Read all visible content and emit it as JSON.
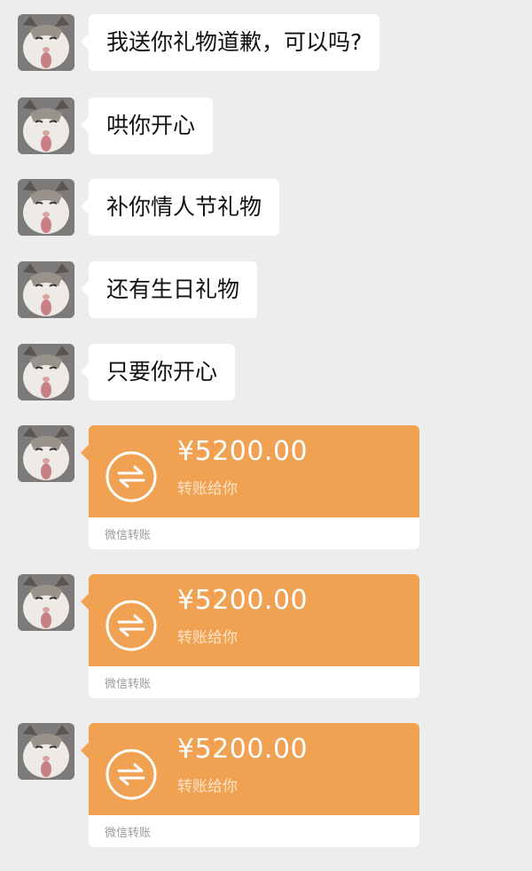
{
  "messages": [
    {
      "text": "我送你礼物道歉，可以吗?"
    },
    {
      "text": "哄你开心"
    },
    {
      "text": "补你情人节礼物"
    },
    {
      "text": "还有生日礼物"
    },
    {
      "text": "只要你开心"
    }
  ],
  "transfers": [
    {
      "amount": "¥5200.00",
      "desc": "转账给你",
      "footer": "微信转账"
    },
    {
      "amount": "¥5200.00",
      "desc": "转账给你",
      "footer": "微信转账"
    },
    {
      "amount": "¥5200.00",
      "desc": "转账给你",
      "footer": "微信转账"
    }
  ],
  "colors": {
    "background": "#ededed",
    "bubble": "#ffffff",
    "transfer_card": "#f0a151"
  },
  "icons": {
    "avatar": "cat-avatar-icon",
    "transfer": "transfer-arrows-icon"
  }
}
